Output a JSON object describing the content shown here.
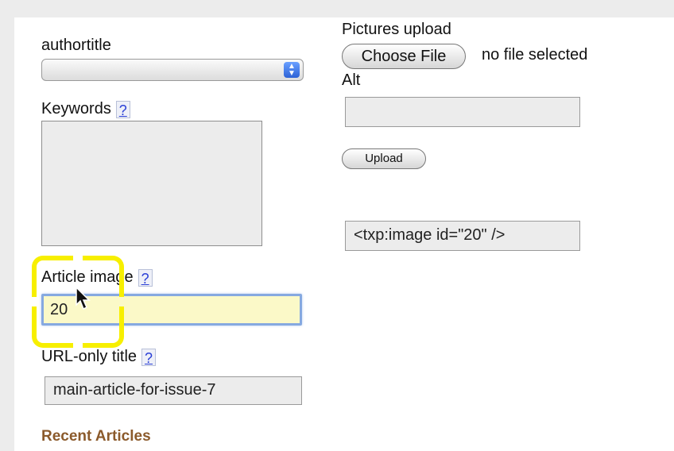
{
  "form": {
    "authortitle": {
      "label": "authortitle",
      "value": ""
    },
    "keywords": {
      "label": "Keywords",
      "help": "?",
      "value": ""
    },
    "article_image": {
      "label": "Article image",
      "help": "?",
      "value": "20"
    },
    "url_title": {
      "label": "URL-only title",
      "help": "?",
      "value": "main-article-for-issue-7"
    },
    "recent_articles": {
      "label": "Recent Articles"
    }
  },
  "upload": {
    "title": "Pictures upload",
    "choose_button": "Choose File",
    "no_file": "no file selected",
    "alt_label": "Alt",
    "alt_value": "",
    "upload_button": "Upload",
    "tag_output": "<txp:image id=\"20\" />"
  },
  "icons": {
    "select": "select-arrows-icon",
    "cursor": "mouse-pointer-icon"
  },
  "colors": {
    "highlight": "#f7ef00",
    "section": "#8b5a2b",
    "focus_bg": "#fbf9c8"
  }
}
